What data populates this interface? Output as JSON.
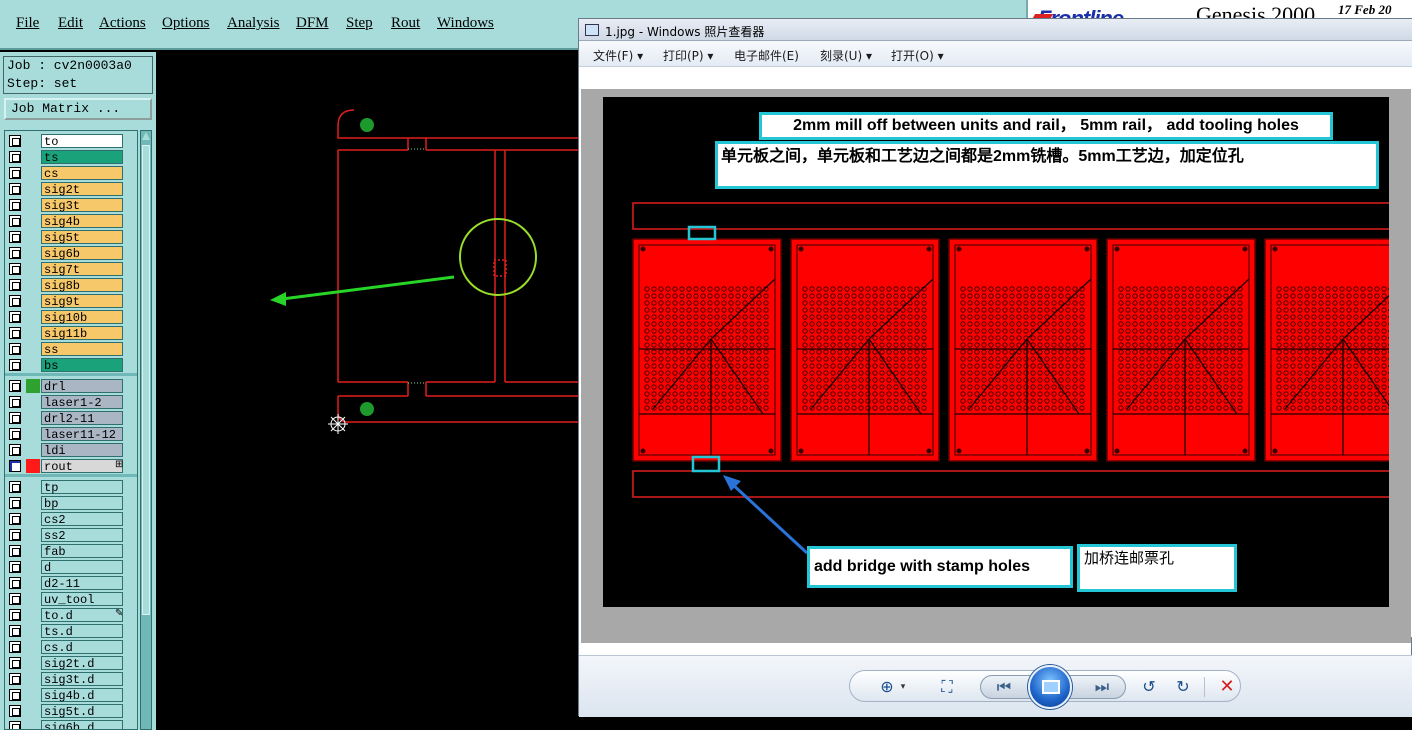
{
  "genesis": {
    "menu": [
      "File",
      "Edit",
      "Actions",
      "Options",
      "Analysis",
      "DFM",
      "Step",
      "Rout",
      "Windows"
    ],
    "brand": {
      "logo_text": "Frontline",
      "title": "Genesis 2000",
      "date": "17 Feb 20"
    },
    "job_label": "Job : cv2n0003a0",
    "step_label": "Step: set",
    "job_matrix_button": "Job Matrix ...",
    "layer_groups": [
      [
        {
          "name": "to",
          "color": "#ffffff",
          "checked": false
        },
        {
          "name": "ts",
          "color": "#1aa37a",
          "checked": false
        },
        {
          "name": "cs",
          "color": "#f7c86a",
          "checked": false
        },
        {
          "name": "sig2t",
          "color": "#f7c86a",
          "checked": false
        },
        {
          "name": "sig3t",
          "color": "#f7c86a",
          "checked": false
        },
        {
          "name": "sig4b",
          "color": "#f7c86a",
          "checked": false
        },
        {
          "name": "sig5t",
          "color": "#f7c86a",
          "checked": false
        },
        {
          "name": "sig6b",
          "color": "#f7c86a",
          "checked": false
        },
        {
          "name": "sig7t",
          "color": "#f7c86a",
          "checked": false
        },
        {
          "name": "sig8b",
          "color": "#f7c86a",
          "checked": false
        },
        {
          "name": "sig9t",
          "color": "#f7c86a",
          "checked": false
        },
        {
          "name": "sig10b",
          "color": "#f7c86a",
          "checked": false
        },
        {
          "name": "sig11b",
          "color": "#f7c86a",
          "checked": false
        },
        {
          "name": "ss",
          "color": "#f7c86a",
          "checked": false
        },
        {
          "name": "bs",
          "color": "#1aa37a",
          "checked": false
        }
      ],
      [
        {
          "name": "drl",
          "color": "#aab6c4",
          "checked": false,
          "swatch": "#2fa12f"
        },
        {
          "name": "laser1-2",
          "color": "#aab6c4",
          "checked": false
        },
        {
          "name": "drl2-11",
          "color": "#aab6c4",
          "checked": false
        },
        {
          "name": "laser11-12",
          "color": "#aab6c4",
          "checked": false
        },
        {
          "name": "ldi",
          "color": "#aab6c4",
          "checked": false
        },
        {
          "name": "rout",
          "color": "#d8d8d8",
          "checked": true,
          "swatch": "#ff1a1a",
          "mark": "⊞"
        }
      ],
      [
        {
          "name": "tp",
          "color": "#a7dcdb",
          "checked": false
        },
        {
          "name": "bp",
          "color": "#a7dcdb",
          "checked": false
        },
        {
          "name": "cs2",
          "color": "#a7dcdb",
          "checked": false
        },
        {
          "name": "ss2",
          "color": "#a7dcdb",
          "checked": false
        },
        {
          "name": "fab",
          "color": "#a7dcdb",
          "checked": false
        },
        {
          "name": "d",
          "color": "#a7dcdb",
          "checked": false
        },
        {
          "name": "d2-11",
          "color": "#a7dcdb",
          "checked": false
        },
        {
          "name": "uv_tool",
          "color": "#a7dcdb",
          "checked": false
        },
        {
          "name": "to.d",
          "color": "#a7dcdb",
          "checked": false,
          "mark": "✎"
        },
        {
          "name": "ts.d",
          "color": "#a7dcdb",
          "checked": false
        },
        {
          "name": "cs.d",
          "color": "#a7dcdb",
          "checked": false
        },
        {
          "name": "sig2t.d",
          "color": "#a7dcdb",
          "checked": false
        },
        {
          "name": "sig3t.d",
          "color": "#a7dcdb",
          "checked": false
        },
        {
          "name": "sig4b.d",
          "color": "#a7dcdb",
          "checked": false
        },
        {
          "name": "sig5t.d",
          "color": "#a7dcdb",
          "checked": false
        },
        {
          "name": "sig6b.d",
          "color": "#a7dcdb",
          "checked": false
        }
      ]
    ]
  },
  "viewer": {
    "title": "1.jpg - Windows 照片查看器",
    "commands": [
      "文件(F) ▾",
      "打印(P) ▾",
      "电子邮件(E)",
      "刻录(U) ▾",
      "打开(O) ▾"
    ],
    "annotations": {
      "english_top": "2mm mill off between units and rail， 5mm rail， add tooling holes",
      "chinese_top": "单元板之间，单元板和工艺边之间都是2mm铣槽。5mm工艺边，加定位孔",
      "english_bottom": "add bridge with stamp holes",
      "chinese_bottom": "加桥连邮票孔"
    },
    "controls": {
      "zoom": "zoom-icon",
      "actual_size": "fit-icon",
      "previous": "previous-icon",
      "slideshow": "slideshow-icon",
      "next": "next-icon",
      "rotate_left": "rotate-ccw-icon",
      "rotate_right": "rotate-cw-icon",
      "delete": "delete-icon"
    },
    "colors": {
      "pcb_red": "#ff0000",
      "highlight": "#24c6d6",
      "arrow_blue": "#2a73d9",
      "annotation_arrow_green": "#27d427"
    }
  }
}
